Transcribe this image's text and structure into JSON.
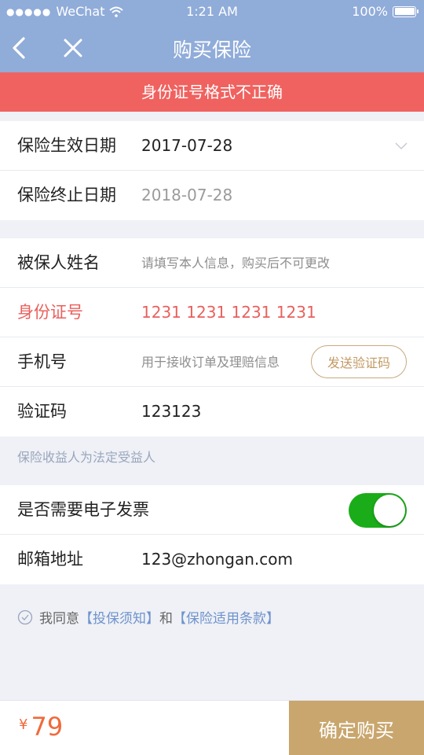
{
  "status_bar": {
    "carrier": "WeChat",
    "time": "1:21 AM",
    "battery": "100%",
    "signal_icon": "signal-dots-icon",
    "wifi_icon": "wifi-icon",
    "battery_icon": "battery-icon"
  },
  "nav": {
    "title": "购买保险",
    "back_icon": "back-chevron-icon",
    "close_icon": "close-icon"
  },
  "error_banner": {
    "text": "身份证号格式不正确",
    "color": "#f0625f"
  },
  "dates": {
    "start_label": "保险生效日期",
    "start_value": "2017-07-28",
    "end_label": "保险终止日期",
    "end_value": "2018-07-28"
  },
  "insured": {
    "name_label": "被保人姓名",
    "name_placeholder": "请填写本人信息，购买后不可更改",
    "id_label": "身份证号",
    "id_value": "1231 1231 1231 1231",
    "phone_label": "手机号",
    "phone_placeholder": "用于接收订单及理赔信息",
    "send_code_label": "发送验证码",
    "code_label": "验证码",
    "code_value": "123123"
  },
  "beneficiary_hint": "保险收益人为法定受益人",
  "invoice": {
    "need_label": "是否需要电子发票",
    "toggle_on": true,
    "email_label": "邮箱地址",
    "email_value": "123@zhongan.com"
  },
  "agreement": {
    "prefix": "我同意",
    "link1": "【投保须知】",
    "middle": "和",
    "link2": "【保险适用条款】"
  },
  "footer": {
    "currency": "¥",
    "price": "79",
    "buy_label": "确定购买"
  },
  "colors": {
    "nav": "#90acd9",
    "error": "#e9605d",
    "toggle_on": "#1aad19",
    "gold": "#c9a66d",
    "price": "#f06a3c"
  }
}
